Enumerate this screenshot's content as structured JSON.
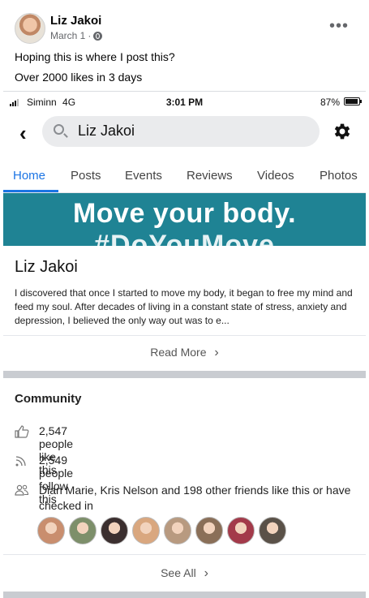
{
  "post": {
    "author": "Liz Jakoi",
    "date": "March 1",
    "date_separator": "·",
    "more_icon": "ellipsis-icon",
    "text_line1": "Hoping this is where I post this?",
    "text_line2": "Over 2000 likes in 3 days"
  },
  "status_bar": {
    "carrier": "Siminn",
    "network": "4G",
    "time": "3:01 PM",
    "battery": "87%"
  },
  "search": {
    "value": "Liz Jakoi",
    "back_icon": "chevron-left-icon",
    "settings_icon": "gear-icon"
  },
  "tabs": [
    {
      "label": "Home",
      "active": true
    },
    {
      "label": "Posts"
    },
    {
      "label": "Events"
    },
    {
      "label": "Reviews"
    },
    {
      "label": "Videos"
    },
    {
      "label": "Photos"
    }
  ],
  "banner": {
    "line1": "Move your body.",
    "line2": "#DoYouMove"
  },
  "page": {
    "name": "Liz Jakoi",
    "about": "I discovered that once I started to move my body, it began to free my mind and feed my soul.  After decades of living in a constant state of stress, anxiety and depression, I believed the only way out was to e...",
    "read_more": "Read More",
    "read_more_icon": "chevron-right-icon"
  },
  "community": {
    "title": "Community",
    "likes": "2,547 people like this",
    "follows": "2,549 people follow this",
    "friends_text": "Dian Marie, Kris Nelson and 198 other friends like this or have checked in",
    "see_all": "See All",
    "friend_colors": [
      "#c98e6e",
      "#7d8f6a",
      "#3b2f2f",
      "#d9a77f",
      "#b89a80",
      "#8a6f58",
      "#a33a4a",
      "#5a5148"
    ]
  },
  "colors": {
    "accent": "#1b74e4",
    "banner": "#1f8394"
  }
}
